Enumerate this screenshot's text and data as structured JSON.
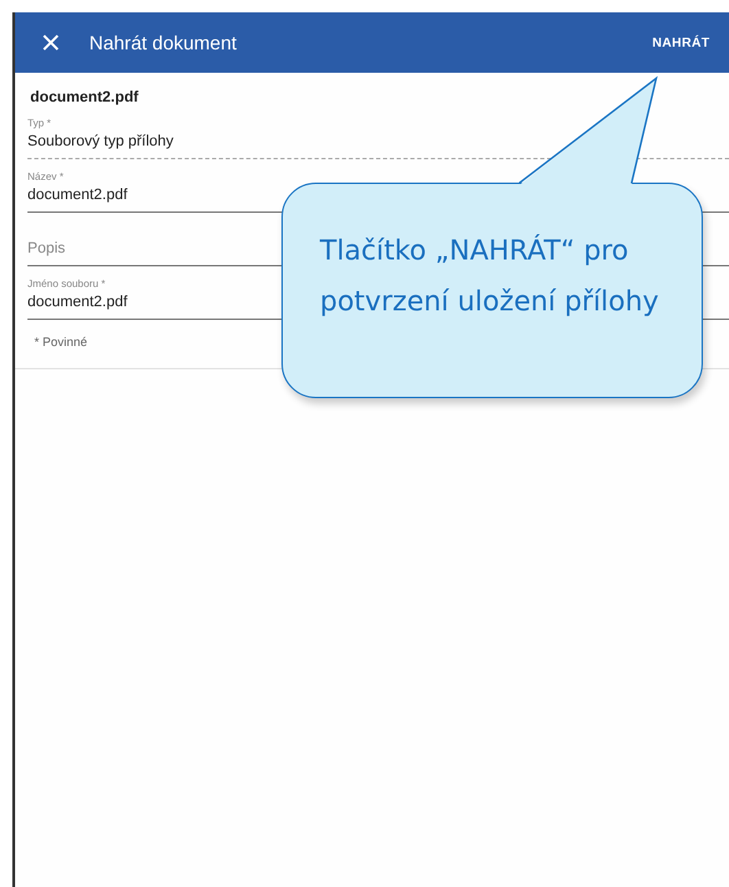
{
  "header": {
    "title": "Nahrát dokument",
    "action": "NAHRÁT"
  },
  "file_name": "document2.pdf",
  "fields": [
    {
      "kind": "select",
      "label": "Typ *",
      "value": "Souborový typ přílohy"
    },
    {
      "kind": "text",
      "label": "Název *",
      "value": "document2.pdf"
    },
    {
      "kind": "text",
      "placeholder": "Popis"
    },
    {
      "kind": "text",
      "label": "Jméno souboru *",
      "value": "document2.pdf"
    }
  ],
  "required_note": "* Povinné",
  "callout": {
    "text": "Tlačítko „NAHRÁT“ pro potvrzení uložení přílohy"
  }
}
